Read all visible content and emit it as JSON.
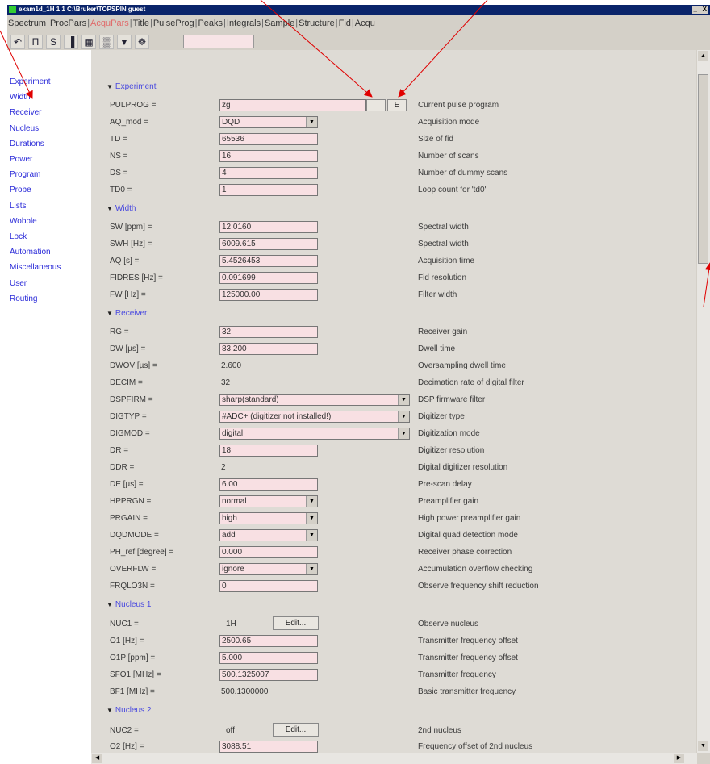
{
  "window": {
    "title": "exam1d_1H 1 1 C:\\Bruker\\TOPSPIN guest",
    "controls": "_   X"
  },
  "tabs": [
    "Spectrum",
    "ProcPars",
    "AcquPars",
    "Title",
    "PulseProg",
    "Peaks",
    "Integrals",
    "Sample",
    "Structure",
    "Fid",
    "Acqu"
  ],
  "active_tab": "AcquPars",
  "toolbar": {
    "icons": [
      "undo-icon",
      "pulse-icon",
      "s-icon",
      "probe-icon",
      "table-icon",
      "prosol-icon",
      "filter-icon",
      "binoculars-icon"
    ],
    "glyphs": [
      "↶",
      "Π",
      "S",
      "▐",
      "▦",
      "▒",
      "▼",
      "☸"
    ],
    "search_value": ""
  },
  "nav": [
    "Experiment",
    "Width",
    "Receiver",
    "Nucleus",
    "Durations",
    "Power",
    "Program",
    "Probe",
    "Lists",
    "Wobble",
    "Lock",
    "Automation",
    "Miscellaneous",
    "User",
    "Routing"
  ],
  "sections": {
    "experiment": "Experiment",
    "width": "Width",
    "receiver": "Receiver",
    "nucleus1": "Nucleus 1",
    "nucleus2": "Nucleus 2"
  },
  "params": {
    "pulprog": {
      "label": "PULPROG =",
      "value": "zg",
      "desc": "Current pulse program",
      "btn1": "",
      "btn2": "E"
    },
    "aq_mod": {
      "label": "AQ_mod =",
      "value": "DQD",
      "desc": "Acquisition mode"
    },
    "td": {
      "label": "TD =",
      "value": "65536",
      "desc": "Size of fid"
    },
    "ns": {
      "label": "NS =",
      "value": "16",
      "desc": "Number of scans"
    },
    "ds": {
      "label": "DS =",
      "value": "4",
      "desc": "Number of dummy scans"
    },
    "td0": {
      "label": "TD0 =",
      "value": "1",
      "desc": "Loop count for 'td0'"
    },
    "sw": {
      "label": "SW [ppm] =",
      "value": "12.0160",
      "desc": "Spectral width"
    },
    "swh": {
      "label": "SWH [Hz] =",
      "value": "6009.615",
      "desc": "Spectral width"
    },
    "aq": {
      "label": "AQ [s] =",
      "value": "5.4526453",
      "desc": "Acquisition time"
    },
    "fidres": {
      "label": "FIDRES [Hz] =",
      "value": "0.091699",
      "desc": "Fid resolution"
    },
    "fw": {
      "label": "FW [Hz] =",
      "value": "125000.00",
      "desc": "Filter width"
    },
    "rg": {
      "label": "RG =",
      "value": "32",
      "desc": "Receiver gain"
    },
    "dw": {
      "label": "DW [µs] =",
      "value": "83.200",
      "desc": "Dwell time"
    },
    "dwov": {
      "label": "DWOV [µs] =",
      "value": "2.600",
      "desc": "Oversampling dwell time"
    },
    "decim": {
      "label": "DECIM =",
      "value": "32",
      "desc": "Decimation rate of digital filter"
    },
    "dspfirm": {
      "label": "DSPFIRM =",
      "value": "sharp(standard)",
      "desc": "DSP firmware filter"
    },
    "digtyp": {
      "label": "DIGTYP =",
      "value": "#ADC+ (digitizer not installed!)",
      "desc": "Digitizer type"
    },
    "digmod": {
      "label": "DIGMOD =",
      "value": "digital",
      "desc": "Digitization mode"
    },
    "dr": {
      "label": "DR =",
      "value": "18",
      "desc": "Digitizer resolution"
    },
    "ddr": {
      "label": "DDR =",
      "value": "2",
      "desc": "Digital digitizer resolution"
    },
    "de": {
      "label": "DE [µs] =",
      "value": "6.00",
      "desc": "Pre-scan delay"
    },
    "hpprgn": {
      "label": "HPPRGN =",
      "value": "normal",
      "desc": "Preamplifier gain"
    },
    "prgain": {
      "label": "PRGAIN =",
      "value": "high",
      "desc": "High power preamplifier gain"
    },
    "dqdmode": {
      "label": "DQDMODE =",
      "value": "add",
      "desc": "Digital quad detection mode"
    },
    "ph_ref": {
      "label": "PH_ref [degree] =",
      "value": "0.000",
      "desc": "Receiver phase correction"
    },
    "overflw": {
      "label": "OVERFLW =",
      "value": "ignore",
      "desc": "Accumulation overflow checking"
    },
    "frqlo3n": {
      "label": "FRQLO3N =",
      "value": "0",
      "desc": "Observe frequency shift reduction"
    },
    "nuc1": {
      "label": "NUC1 =",
      "value": "1H",
      "btn": "Edit...",
      "desc": "Observe nucleus"
    },
    "o1": {
      "label": "O1 [Hz] =",
      "value": "2500.65",
      "desc": "Transmitter frequency offset"
    },
    "o1p": {
      "label": "O1P [ppm] =",
      "value": "5.000",
      "desc": "Transmitter frequency offset"
    },
    "sfo1": {
      "label": "SFO1 [MHz] =",
      "value": "500.1325007",
      "desc": "Transmitter frequency"
    },
    "bf1": {
      "label": "BF1 [MHz] =",
      "value": "500.1300000",
      "desc": "Basic transmitter frequency"
    },
    "nuc2": {
      "label": "NUC2 =",
      "value": "off",
      "btn": "Edit...",
      "desc": "2nd nucleus"
    },
    "o2": {
      "label": "O2 [Hz] =",
      "value": "3088.51",
      "desc": "Frequency offset of 2nd nucleus"
    }
  },
  "scroll": {
    "up": "▲",
    "down": "▼",
    "left": "◀",
    "right": "▶"
  },
  "annotation_color": "#e00000"
}
